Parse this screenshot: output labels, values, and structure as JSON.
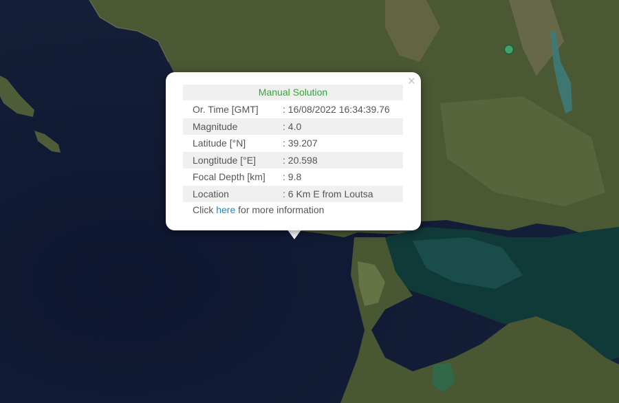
{
  "popup": {
    "close_icon": "×",
    "title": "Manual Solution",
    "rows": [
      {
        "label": "Or. Time [GMT]",
        "value": ": 16/08/2022 16:34:39.76"
      },
      {
        "label": "Magnitude",
        "value": ": 4.0"
      },
      {
        "label": "Latitude [°N]",
        "value": ": 39.207"
      },
      {
        "label": "Longtitude [°E]",
        "value": ": 20.598"
      },
      {
        "label": "Focal Depth [km]",
        "value": ": 9.8"
      },
      {
        "label": "Location",
        "value": ": 6 Km E from Loutsa"
      }
    ],
    "more_prefix": "Click",
    "more_link": "here",
    "more_suffix": "for more information"
  },
  "colors": {
    "sea": "#121b33",
    "land": "#4a5a35",
    "title_green": "#35a435",
    "link_blue": "#1b8ac2",
    "marker": "#3fa36b"
  }
}
